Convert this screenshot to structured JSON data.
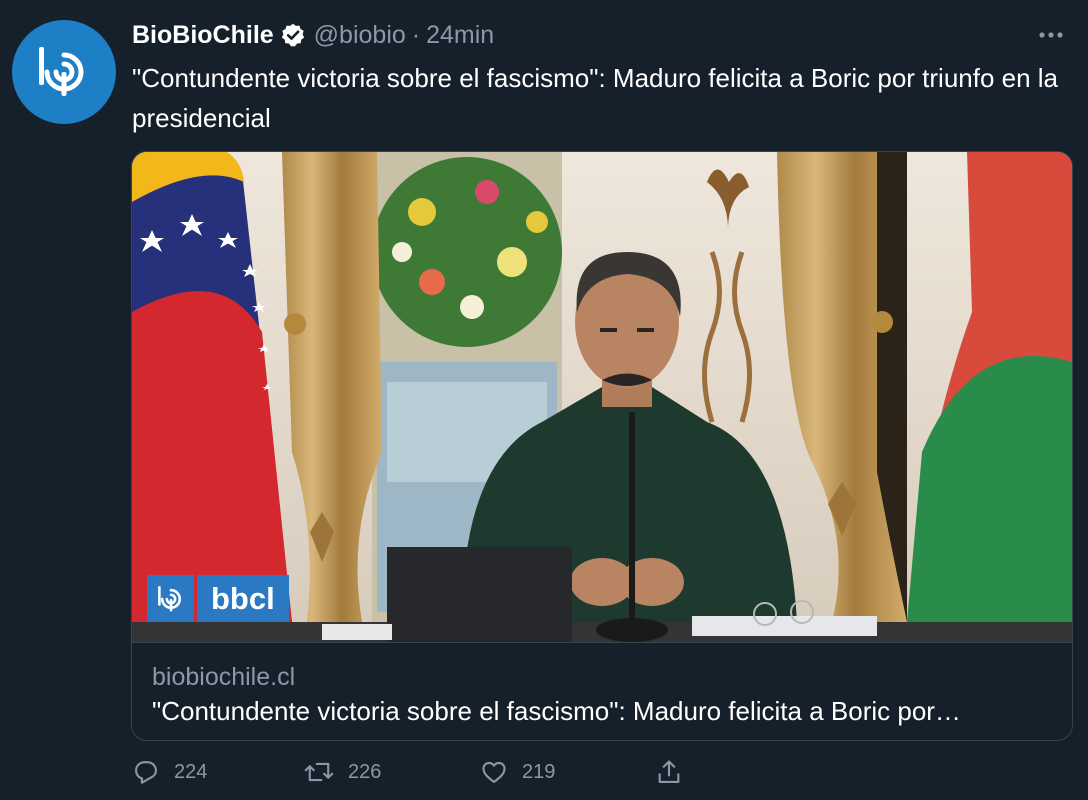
{
  "account": {
    "display_name": "BioBioChile",
    "handle": "@biobio",
    "separator": "·",
    "time": "24min",
    "avatar_icon": "biobio-logo-icon",
    "verified_icon": "verified-badge-icon"
  },
  "tweet": {
    "text": "\"Contundente victoria sobre el fascismo\": Maduro felicita a Boric por triunfo en la presidencial"
  },
  "card": {
    "domain": "biobiochile.cl",
    "title": "\"Contundente victoria sobre el fascismo\": Maduro felicita a Boric por…",
    "watermark_text": "bbcl"
  },
  "actions": {
    "replies": "224",
    "retweets": "226",
    "likes": "219"
  },
  "colors": {
    "background": "#15202b",
    "secondary_text": "#8b98a5",
    "border": "#38444d",
    "brand_blue": "#1d7fc6"
  }
}
